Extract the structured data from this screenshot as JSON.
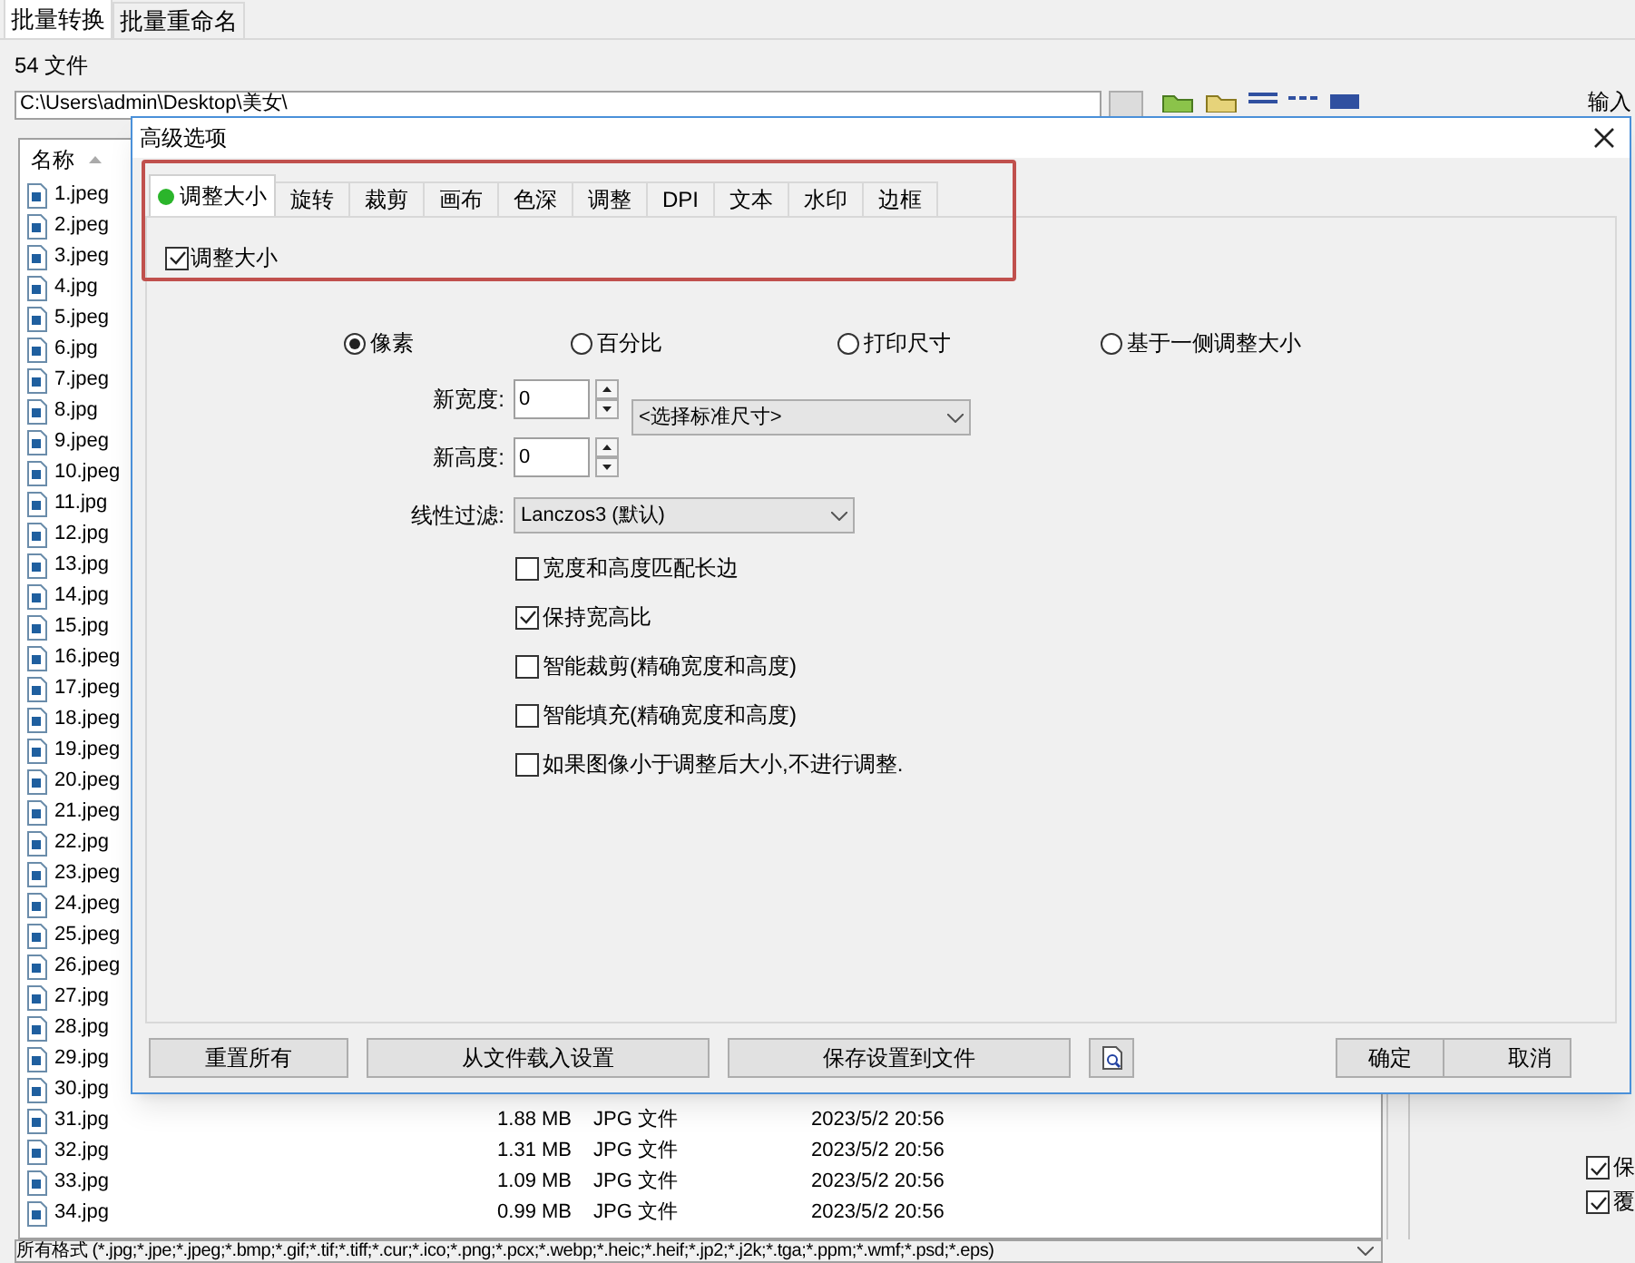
{
  "main_tabs": [
    {
      "label": "批量转换",
      "selected": true
    },
    {
      "label": "批量重命名",
      "selected": false
    }
  ],
  "file_count": "54 文件",
  "path": "C:\\Users\\admin\\Desktop\\美女\\",
  "input_label": "输入",
  "file_list": {
    "columns": [
      "名称"
    ],
    "files": [
      {
        "name": "1.jpeg"
      },
      {
        "name": "2.jpeg"
      },
      {
        "name": "3.jpeg"
      },
      {
        "name": "4.jpg"
      },
      {
        "name": "5.jpeg"
      },
      {
        "name": "6.jpg"
      },
      {
        "name": "7.jpeg"
      },
      {
        "name": "8.jpg"
      },
      {
        "name": "9.jpeg"
      },
      {
        "name": "10.jpeg"
      },
      {
        "name": "11.jpg"
      },
      {
        "name": "12.jpg"
      },
      {
        "name": "13.jpg"
      },
      {
        "name": "14.jpg"
      },
      {
        "name": "15.jpg"
      },
      {
        "name": "16.jpeg"
      },
      {
        "name": "17.jpeg"
      },
      {
        "name": "18.jpeg"
      },
      {
        "name": "19.jpeg"
      },
      {
        "name": "20.jpeg"
      },
      {
        "name": "21.jpeg"
      },
      {
        "name": "22.jpg"
      },
      {
        "name": "23.jpeg"
      },
      {
        "name": "24.jpeg"
      },
      {
        "name": "25.jpeg"
      },
      {
        "name": "26.jpeg"
      },
      {
        "name": "27.jpg"
      },
      {
        "name": "28.jpg"
      },
      {
        "name": "29.jpg"
      },
      {
        "name": "30.jpg"
      },
      {
        "name": "31.jpg",
        "size": "1.88 MB",
        "type": "JPG 文件",
        "date": "2023/5/2 20:56"
      },
      {
        "name": "32.jpg",
        "size": "1.31 MB",
        "type": "JPG 文件",
        "date": "2023/5/2 20:56"
      },
      {
        "name": "33.jpg",
        "size": "1.09 MB",
        "type": "JPG 文件",
        "date": "2023/5/2 20:56"
      },
      {
        "name": "34.jpg",
        "size": "0.99 MB",
        "type": "JPG 文件",
        "date": "2023/5/2 20:56"
      }
    ]
  },
  "right_options": [
    {
      "label": "保",
      "checked": true
    },
    {
      "label": "覆",
      "checked": true
    }
  ],
  "filter": "所有格式 (*.jpg;*.jpe;*.jpeg;*.bmp;*.gif;*.tif;*.tiff;*.cur;*.ico;*.png;*.pcx;*.webp;*.heic;*.heif;*.jp2;*.j2k;*.tga;*.ppm;*.wmf;*.psd;*.eps)",
  "dialog": {
    "title": "高级选项",
    "tabs": [
      {
        "label": "调整大小",
        "selected": true
      },
      {
        "label": "旋转",
        "selected": false
      },
      {
        "label": "裁剪",
        "selected": false
      },
      {
        "label": "画布",
        "selected": false
      },
      {
        "label": "色深",
        "selected": false
      },
      {
        "label": "调整",
        "selected": false
      },
      {
        "label": "DPI",
        "selected": false
      },
      {
        "label": "文本",
        "selected": false
      },
      {
        "label": "水印",
        "selected": false
      },
      {
        "label": "边框",
        "selected": false
      }
    ],
    "enable": {
      "label": "调整大小",
      "checked": true
    },
    "modes": [
      {
        "label": "像素",
        "selected": true
      },
      {
        "label": "百分比",
        "selected": false
      },
      {
        "label": "打印尺寸",
        "selected": false
      },
      {
        "label": "基于一侧调整大小",
        "selected": false
      }
    ],
    "width": {
      "label": "新宽度:",
      "value": "0"
    },
    "height": {
      "label": "新高度:",
      "value": "0"
    },
    "preset": "<选择标准尺寸>",
    "filter": {
      "label": "线性过滤:",
      "value": "Lanczos3 (默认)"
    },
    "options": [
      {
        "label": "宽度和高度匹配长边",
        "checked": false
      },
      {
        "label": "保持宽高比",
        "checked": true
      },
      {
        "label": "智能裁剪(精确宽度和高度)",
        "checked": false
      },
      {
        "label": "智能填充(精确宽度和高度)",
        "checked": false
      },
      {
        "label": "如果图像小于调整后大小,不进行调整.",
        "checked": false
      }
    ],
    "buttons": [
      "重置所有",
      "从文件载入设置",
      "保存设置到文件"
    ],
    "ok": "确定",
    "cancel": "取消"
  }
}
